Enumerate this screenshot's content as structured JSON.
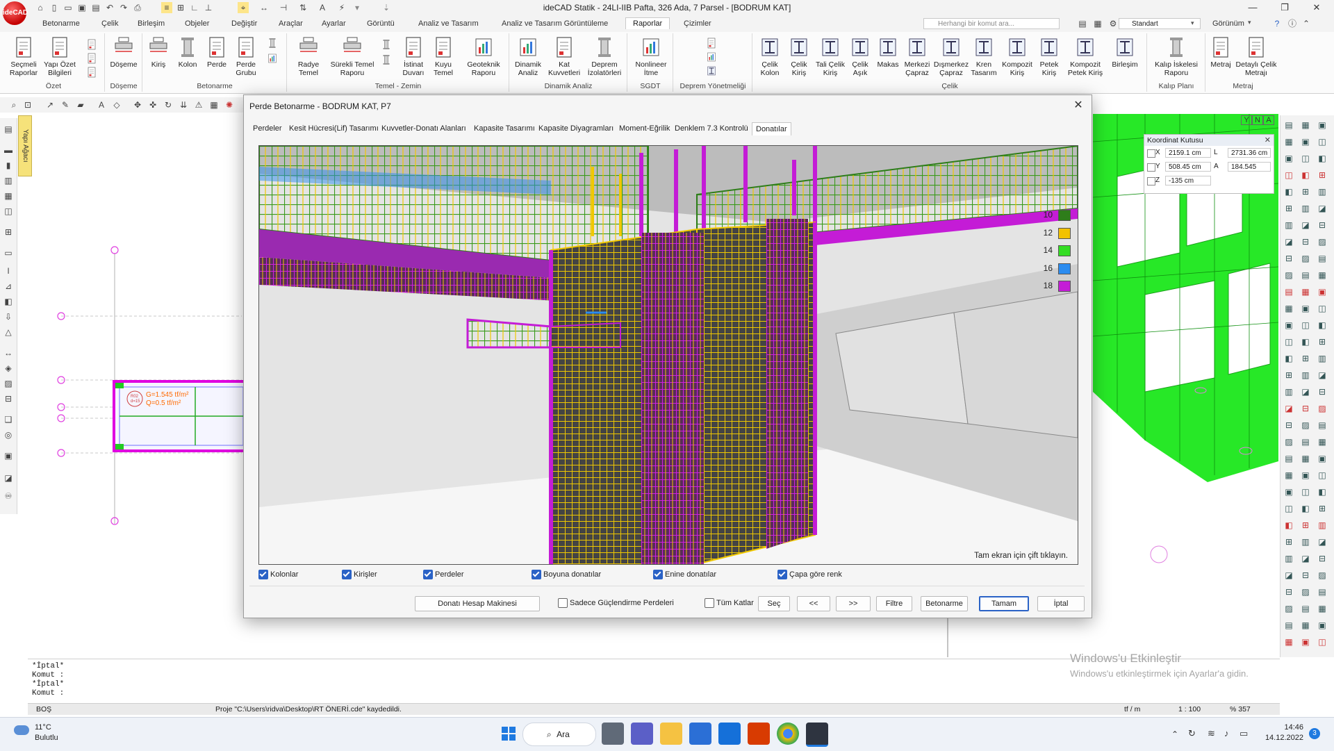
{
  "app": {
    "logo_text": "ideCAD",
    "title": "ideCAD Statik - 24LI-IIB  Pafta, 326 Ada, 7 Parsel - [BODRUM KAT]",
    "win_controls": [
      "—",
      "❐",
      "✕"
    ]
  },
  "menu": {
    "tabs": [
      "Betonarme",
      "Çelik",
      "Birleşim",
      "Objeler",
      "Değiştir",
      "Araçlar",
      "Ayarlar",
      "Görüntü",
      "Analiz ve Tasarım",
      "Analiz ve Tasarım Görüntüleme",
      "Raporlar",
      "Çizimler"
    ],
    "active_tab": "Raporlar",
    "search_placeholder": "Herhangi bir komut ara...",
    "standard_select": "Standart",
    "view_label": "Görünüm"
  },
  "ribbon": {
    "groups": [
      {
        "label": "Özet",
        "buttons": [
          "Seçmeli Raporlar",
          "Yapı Özet Bilgileri"
        ]
      },
      {
        "label": "Döşeme",
        "buttons": [
          "Döşeme"
        ]
      },
      {
        "label": "Betonarme",
        "buttons": [
          "Kiriş",
          "Kolon",
          "Perde",
          "Perde Grubu"
        ]
      },
      {
        "label": "Temel - Zemin",
        "buttons": [
          "Radye Temel",
          "Sürekli Temel Raporu",
          "İstinat Duvarı",
          "Kuyu Temel",
          "Geoteknik Raporu"
        ]
      },
      {
        "label": "Dinamik Analiz",
        "buttons": [
          "Dinamik Analiz",
          "Kat Kuvvetleri",
          "Deprem İzolatörleri"
        ]
      },
      {
        "label": "SGDT",
        "buttons": [
          "Nonlineer İtme"
        ]
      },
      {
        "label": "Deprem Yönetmeliği",
        "buttons": []
      },
      {
        "label": "Çelik",
        "buttons": [
          "Çelik Kolon",
          "Çelik Kiriş",
          "Tali Çelik Kiriş",
          "Çelik Aşık",
          "Makas",
          "Merkezi Çapraz",
          "Dışmerkez Çapraz",
          "Kren Tasarım",
          "Kompozit Kiriş",
          "Petek Kiriş",
          "Kompozit Petek Kiriş",
          "Birleşim"
        ]
      },
      {
        "label": "Kalıp Planı",
        "buttons": [
          "Kalıp İskelesi Raporu"
        ]
      },
      {
        "label": "Metraj",
        "buttons": [
          "Metraj",
          "Detaylı Çelik Metrajı"
        ]
      }
    ]
  },
  "left_panel": {
    "tab_label": "Yapı Ağacı"
  },
  "canvas": {
    "slab_label_1": "G=1.545 tf/m²",
    "slab_label_2": "Q=0.5 tf/m²",
    "slab_tag_1": "R02",
    "slab_tag_2": "d=15"
  },
  "view_cube": [
    "Y",
    "N",
    "A"
  ],
  "coord_box": {
    "title": "Koordinat Kutusu",
    "x_label": "X",
    "x_value": "2159.1 cm",
    "y_label": "Y",
    "y_value": "508.45 cm",
    "z_label": "Z",
    "z_value": "-135 cm",
    "l_label": "L",
    "l_value": "2731.36 cm",
    "a_label": "A",
    "a_value": "184.545"
  },
  "dialog": {
    "title": "Perde Betonarme - BODRUM KAT, P7",
    "tabs": [
      "Perdeler",
      "Kesit Hücresi(Lif) Tasarımı",
      "Kuvvetler-Donatı Alanları",
      "Kapasite Tasarımı",
      "Kapasite Diyagramları",
      "Moment-Eğrilik",
      "Denklem 7.3 Kontrolü",
      "Donatılar"
    ],
    "active_tab": "Donatılar",
    "fullscreen_hint": "Tam ekran için çift tıklayın.",
    "legend": [
      {
        "size": "10",
        "color": "#2e7d1a"
      },
      {
        "size": "12",
        "color": "#f2c200"
      },
      {
        "size": "14",
        "color": "#33dd22"
      },
      {
        "size": "16",
        "color": "#2b8cf0"
      },
      {
        "size": "18",
        "color": "#c41cd6"
      }
    ],
    "checkboxes": [
      {
        "label": "Kolonlar",
        "checked": true
      },
      {
        "label": "Kirişler",
        "checked": true
      },
      {
        "label": "Perdeler",
        "checked": true
      },
      {
        "label": "Boyuna donatılar",
        "checked": true
      },
      {
        "label": "Enine donatılar",
        "checked": true
      },
      {
        "label": "Çapa göre renk",
        "checked": true
      }
    ],
    "btn_calc": "Donatı Hesap Makinesi",
    "chk_only_strengthen": "Sadece Güçlendirme Perdeleri",
    "chk_all_floors": "Tüm Katlar",
    "btn_select": "Seç",
    "btn_prev": "<<",
    "btn_next": ">>",
    "btn_filter": "Filtre",
    "btn_concrete": "Betonarme",
    "btn_ok": "Tamam",
    "btn_cancel": "İptal"
  },
  "command": {
    "lines": [
      "*İptal*",
      "Komut :",
      "*İptal*",
      "Komut :"
    ]
  },
  "status": {
    "mode": "BOŞ",
    "message": "Proje \"C:\\Users\\ridva\\Desktop\\RT ÖNERİ.cde\" kaydedildi.",
    "unit": "tf / m",
    "scale": "1 : 100",
    "zoom": "% 357"
  },
  "watermark": {
    "line1": "Windows'u Etkinleştir",
    "line2": "Windows'u etkinleştirmek için Ayarlar'a gidin."
  },
  "taskbar": {
    "weather_temp": "11°C",
    "weather_desc": "Bulutlu",
    "search_label": "Ara",
    "time": "14:46",
    "date": "14.12.2022",
    "notif_count": "3"
  },
  "colors": {
    "accent": "#2a62c6",
    "magenta": "#e000e0",
    "struct_green": "#22ee22"
  }
}
